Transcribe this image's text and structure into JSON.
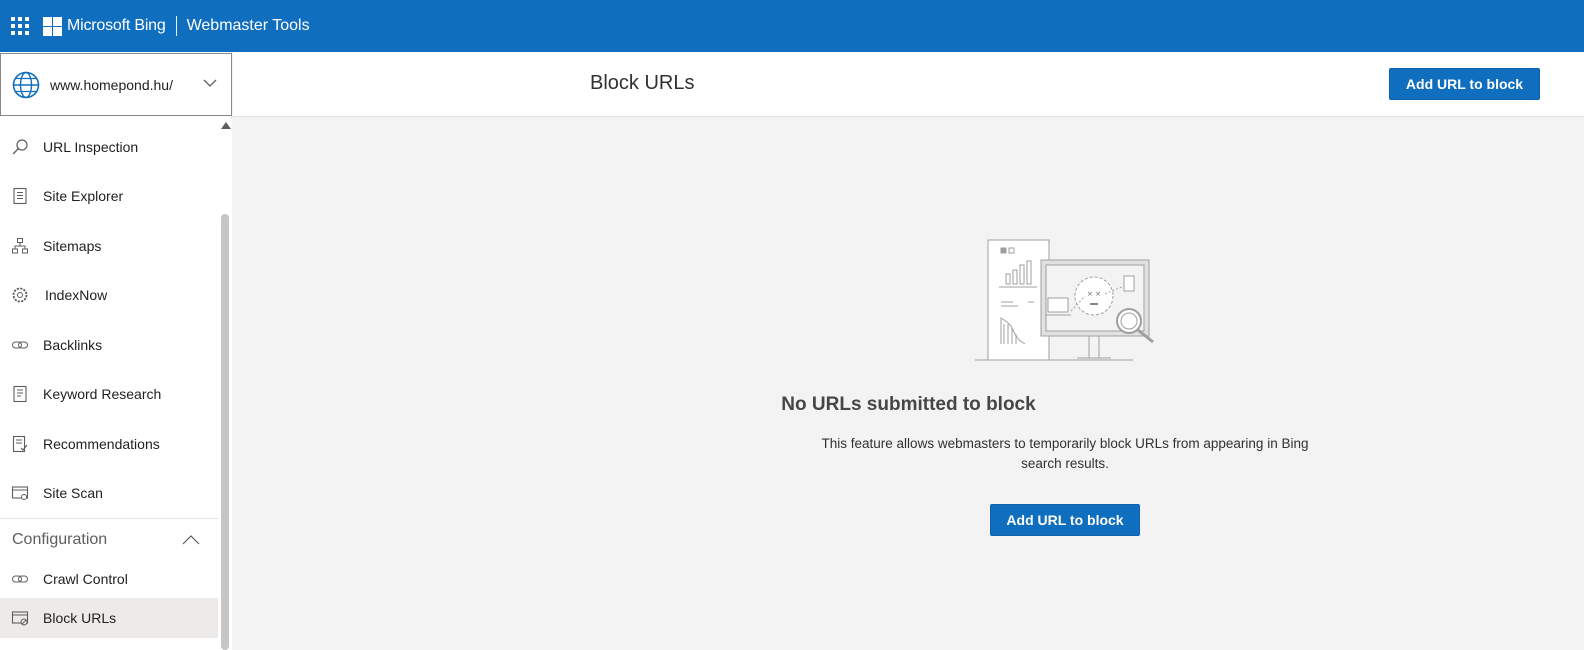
{
  "topbar": {
    "brand": "Microsoft Bing",
    "product": "Webmaster Tools"
  },
  "site_picker": {
    "url": "www.homepond.hu/"
  },
  "sidebar": {
    "items": [
      {
        "label": "URL Inspection",
        "icon": "magnifier-icon"
      },
      {
        "label": "Site Explorer",
        "icon": "document-list-icon"
      },
      {
        "label": "Sitemaps",
        "icon": "sitemap-icon"
      },
      {
        "label": "IndexNow",
        "icon": "gear-icon"
      },
      {
        "label": "Backlinks",
        "icon": "link-icon"
      },
      {
        "label": "Keyword Research",
        "icon": "document-icon"
      },
      {
        "label": "Recommendations",
        "icon": "checklist-icon"
      },
      {
        "label": "Site Scan",
        "icon": "scan-icon"
      }
    ],
    "section": "Configuration",
    "config_items": [
      {
        "label": "Crawl Control",
        "icon": "link-icon"
      },
      {
        "label": "Block URLs",
        "icon": "block-url-icon"
      }
    ]
  },
  "header": {
    "title": "Block URLs",
    "add_button": "Add URL to block"
  },
  "empty_state": {
    "title": "No URLs submitted to block",
    "description": "This feature allows webmasters to temporarily block URLs from appearing in Bing search results.",
    "add_button": "Add URL to block"
  }
}
